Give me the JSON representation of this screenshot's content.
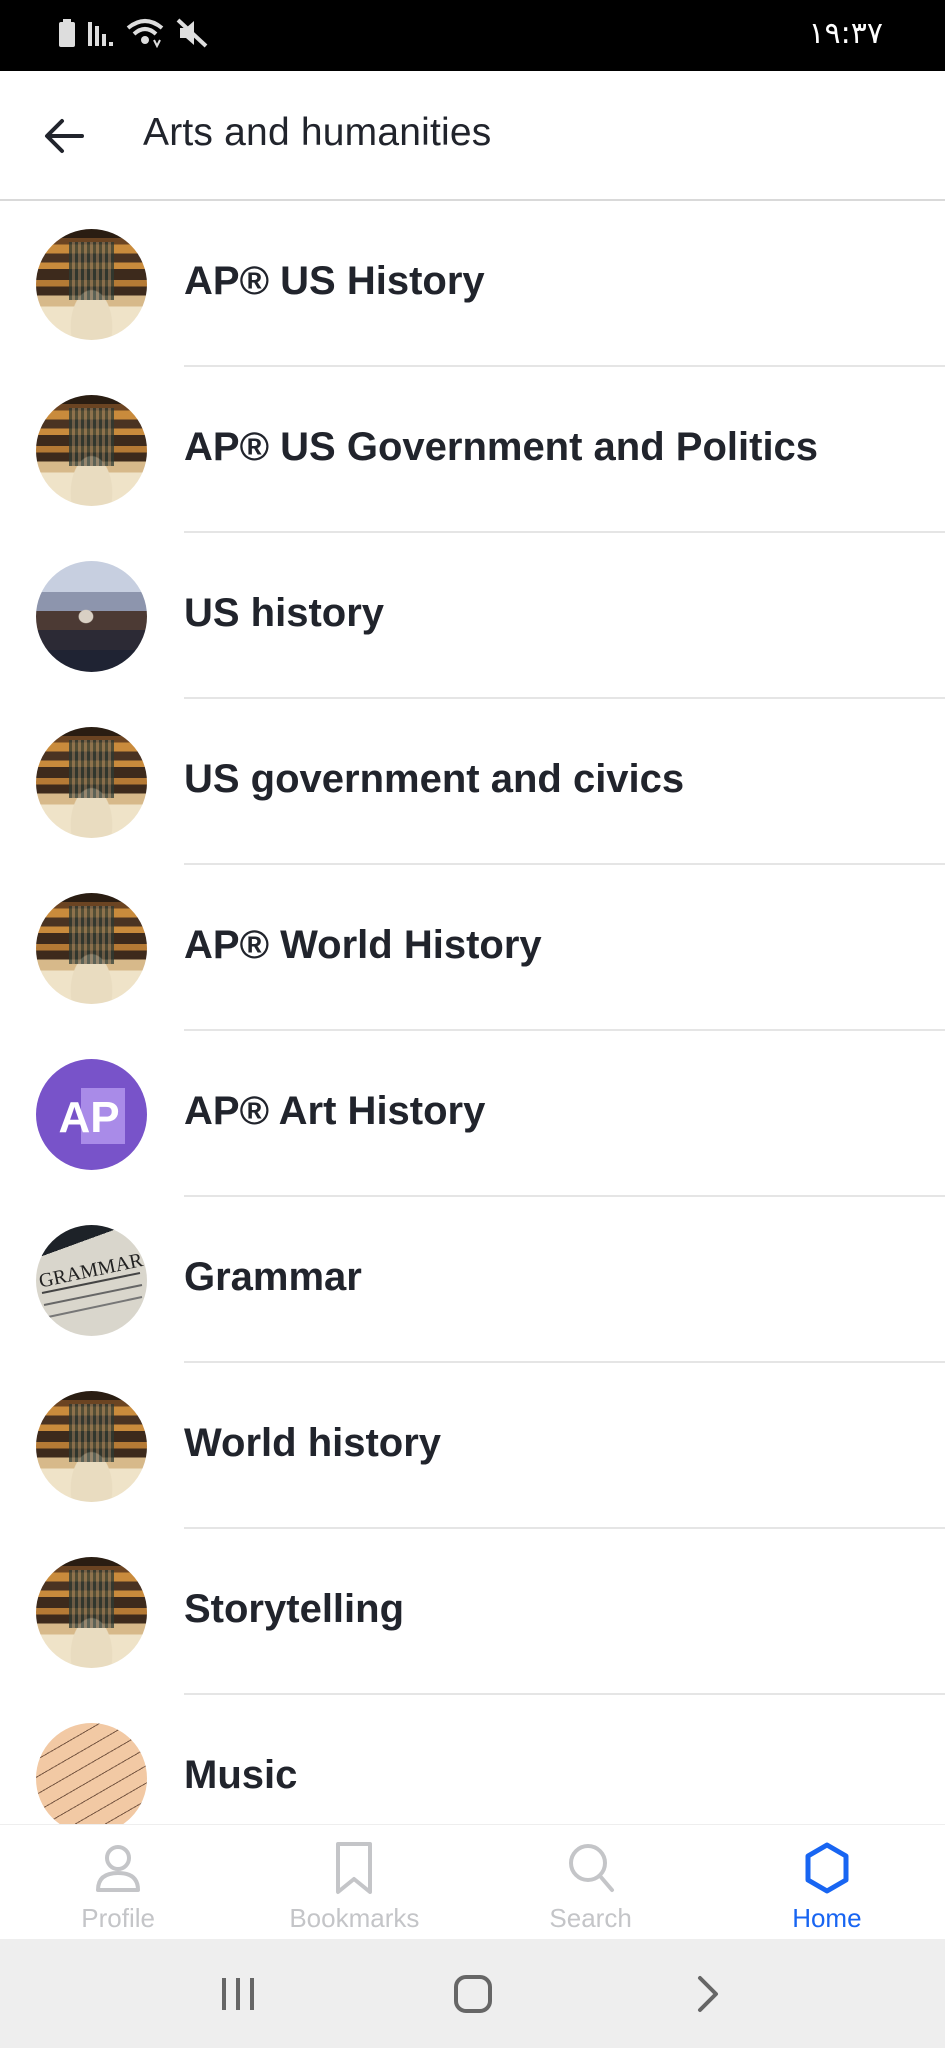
{
  "status_bar": {
    "time": "١٩:٣٧",
    "icons": [
      "battery-icon",
      "signal-icon",
      "wifi-icon",
      "mute-icon"
    ]
  },
  "header": {
    "title": "Arts and humanities",
    "back_icon": "arrow-left-icon"
  },
  "topics": [
    {
      "label": "AP® US History",
      "avatar": "library"
    },
    {
      "label": "AP® US Government and Politics",
      "avatar": "library"
    },
    {
      "label": "US history",
      "avatar": "painting"
    },
    {
      "label": "US government and civics",
      "avatar": "library"
    },
    {
      "label": "AP® World History",
      "avatar": "library"
    },
    {
      "label": "AP® Art History",
      "avatar": "ap-logo",
      "avatar_text": "AP"
    },
    {
      "label": "Grammar",
      "avatar": "grammar-page",
      "avatar_text": "GRAMMAR"
    },
    {
      "label": "World history",
      "avatar": "library"
    },
    {
      "label": "Storytelling",
      "avatar": "library"
    },
    {
      "label": "Music",
      "avatar": "sheet-music"
    }
  ],
  "tabs": [
    {
      "label": "Profile",
      "icon": "profile-icon",
      "active": false
    },
    {
      "label": "Bookmarks",
      "icon": "bookmark-icon",
      "active": false
    },
    {
      "label": "Search",
      "icon": "search-icon",
      "active": false
    },
    {
      "label": "Home",
      "icon": "home-hexagon-icon",
      "active": true
    }
  ],
  "colors": {
    "accent": "#1865f2",
    "inactive": "#c4c5c8",
    "text": "#21242c",
    "ap_purple": "#7853c9"
  }
}
